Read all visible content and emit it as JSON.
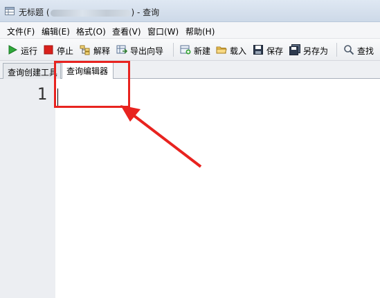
{
  "window": {
    "title_prefix": "无标题 (",
    "title_suffix": ") - 查询"
  },
  "menu": [
    {
      "label": "文件(F)"
    },
    {
      "label": "编辑(E)"
    },
    {
      "label": "格式(O)"
    },
    {
      "label": "查看(V)"
    },
    {
      "label": "窗口(W)"
    },
    {
      "label": "帮助(H)"
    }
  ],
  "toolbar": {
    "run": {
      "label": "运行",
      "icon": "play-icon"
    },
    "stop": {
      "label": "停止",
      "icon": "stop-icon"
    },
    "explain": {
      "label": "解释",
      "icon": "explain-icon"
    },
    "export_wizard": {
      "label": "导出向导",
      "icon": "export-icon"
    },
    "new": {
      "label": "新建",
      "icon": "new-icon"
    },
    "load": {
      "label": "载入",
      "icon": "folder-icon"
    },
    "save": {
      "label": "保存",
      "icon": "save-icon"
    },
    "save_as": {
      "label": "另存为",
      "icon": "save-as-icon"
    },
    "find": {
      "label": "查找",
      "icon": "search-icon"
    }
  },
  "tabs": [
    {
      "label": "查询创建工具"
    },
    {
      "label": "查询编辑器"
    }
  ],
  "editor": {
    "line_number": "1"
  },
  "annotation": {
    "color": "#e8231f"
  }
}
